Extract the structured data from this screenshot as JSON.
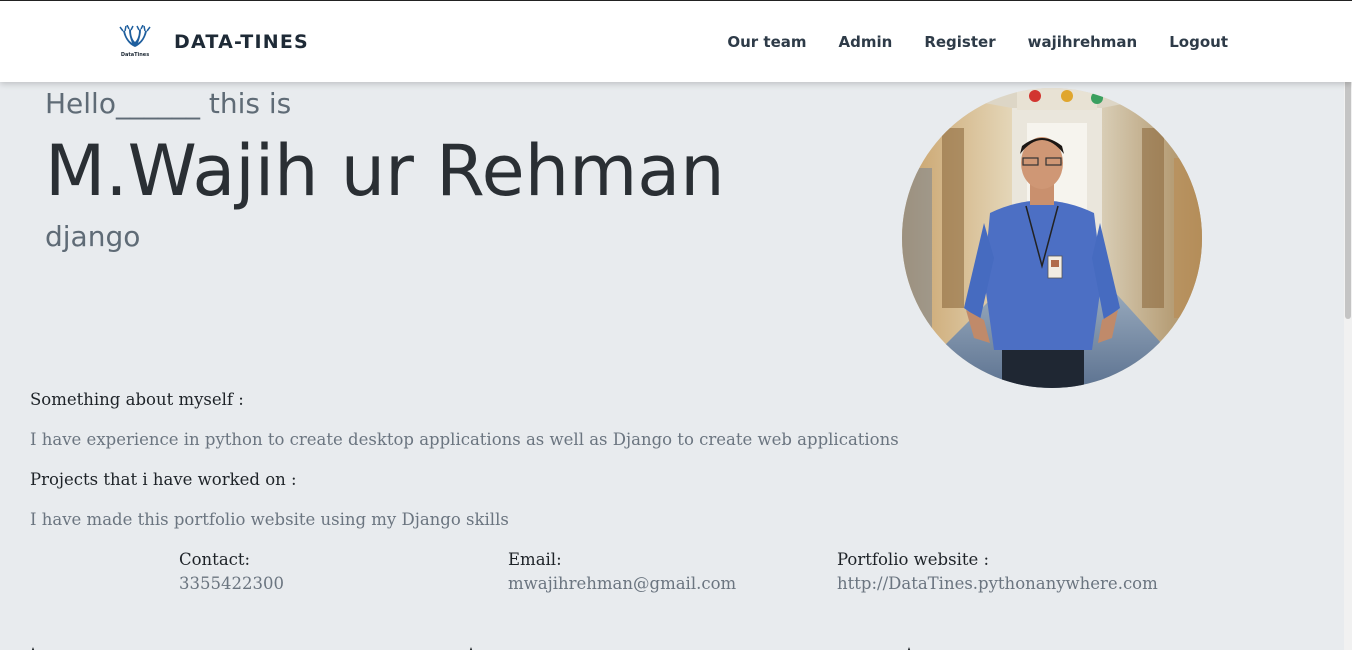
{
  "navbar": {
    "brand": "DATA-TINES",
    "logo_text": "DataTines",
    "links": [
      "Our team",
      "Admin",
      "Register",
      "wajihrehman",
      "Logout"
    ]
  },
  "hero": {
    "greeting": "Hello______ this is",
    "name": "M.Wajih ur Rehman",
    "skill": "django"
  },
  "about": {
    "heading": "Something about myself :",
    "text": "I have experience in python to create desktop applications as well as Django to create web applications"
  },
  "projects": {
    "heading": "Projects that i have worked on :",
    "text": "I have made this portfolio website using my Django skills"
  },
  "contact": {
    "phone_label": "Contact:",
    "phone": "3355422300",
    "email_label": "Email:",
    "email": "mwajihrehman@gmail.com",
    "website_label": "Portfolio website :",
    "website": "http://DataTines.pythonanywhere.com"
  },
  "colors": {
    "page_background": "#e8ebee",
    "navbar_background": "#ffffff",
    "logo_blue": "#1f5f9e"
  }
}
